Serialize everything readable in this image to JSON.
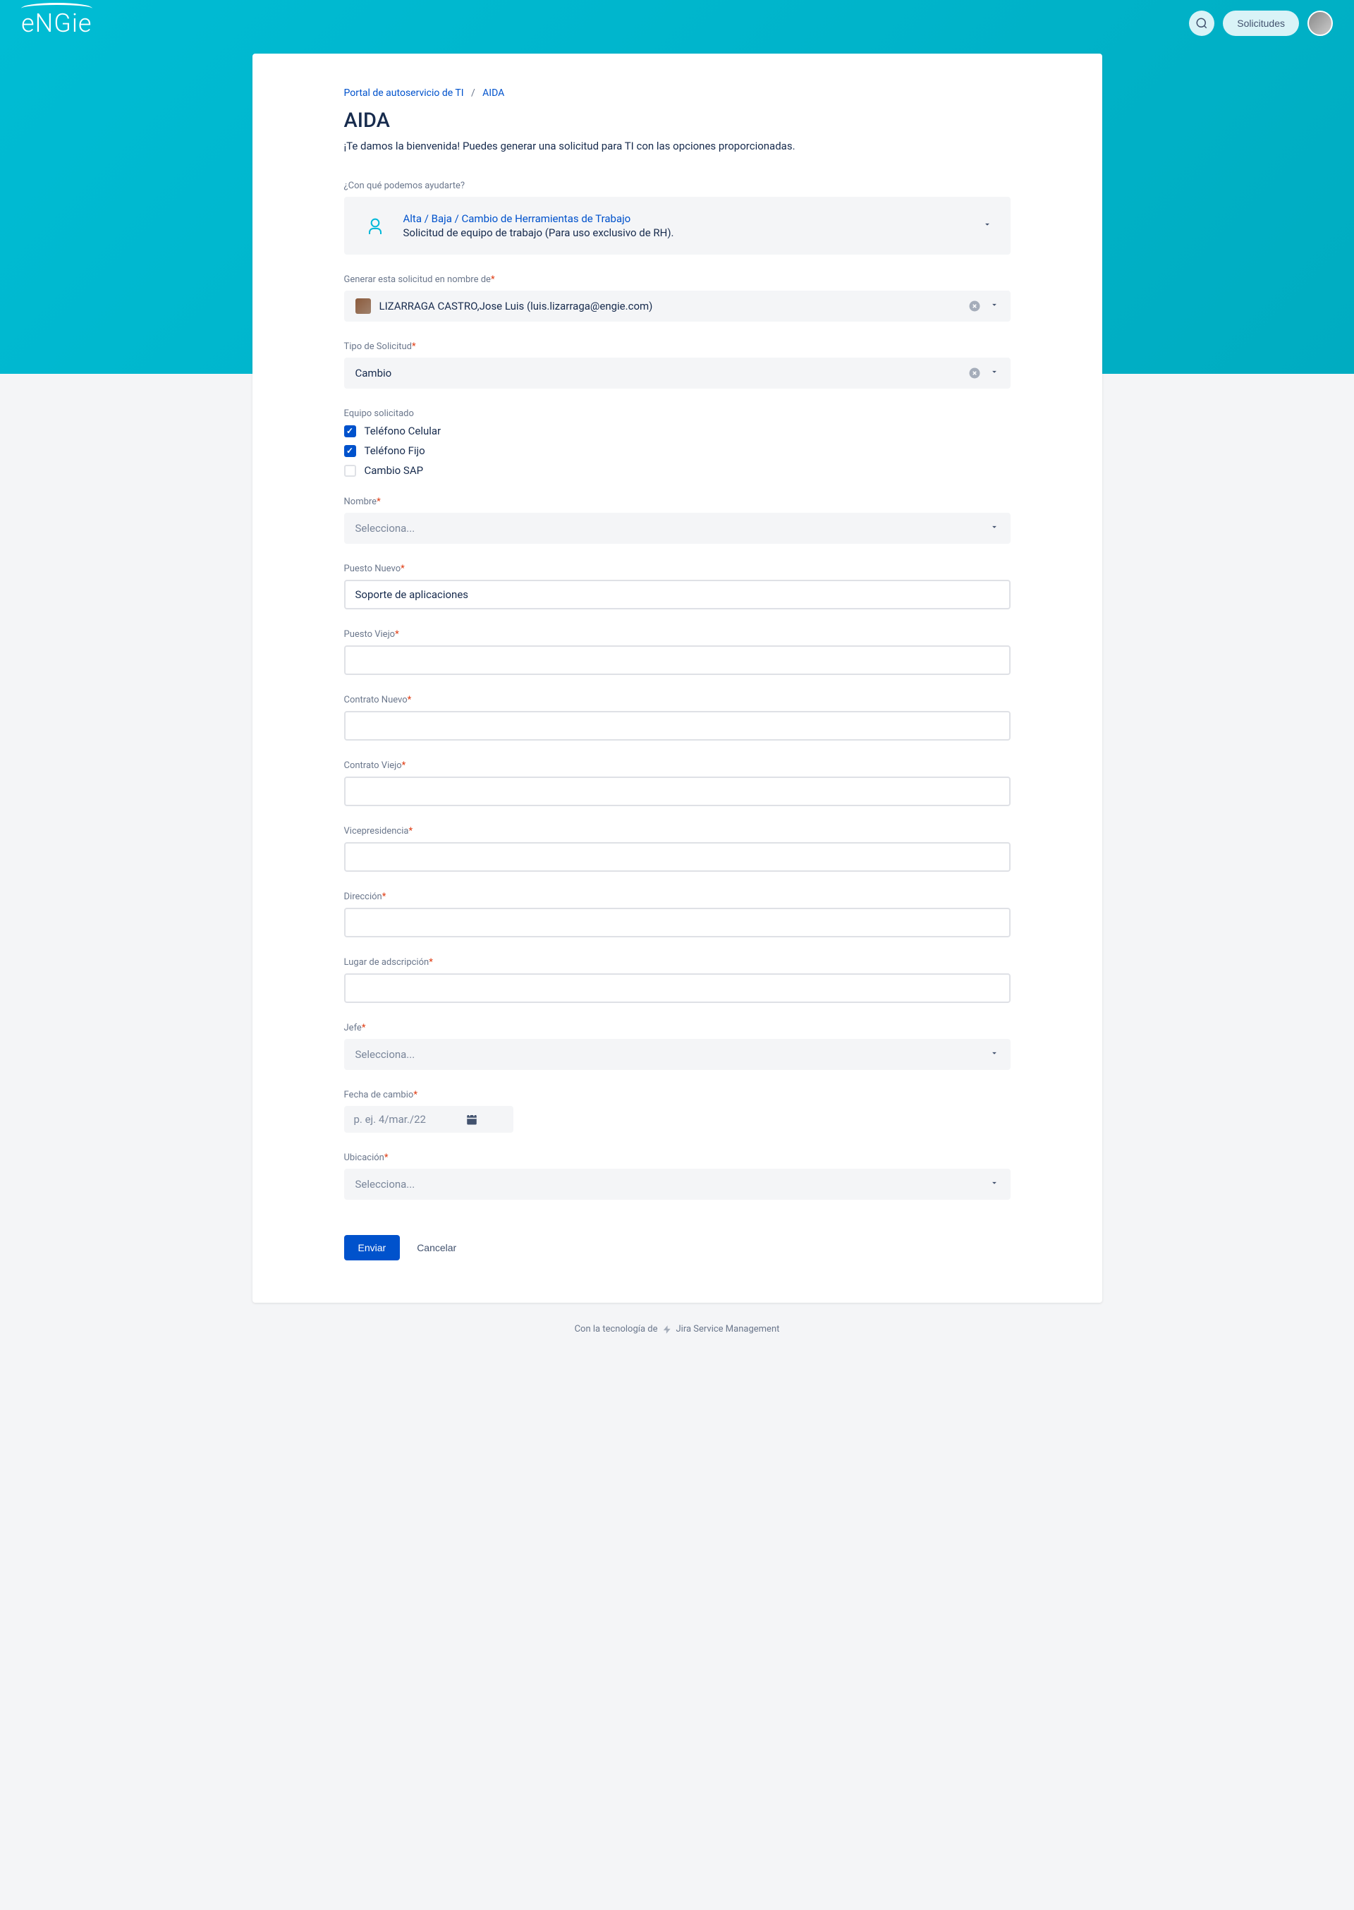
{
  "header": {
    "logo": "eNGie",
    "solicitudes": "Solicitudes"
  },
  "breadcrumb": {
    "portal": "Portal de autoservicio de TI",
    "separator": "/",
    "current": "AIDA"
  },
  "page": {
    "title": "AIDA",
    "subtitle": "¡Te damos la bienvenida! Puedes generar una solicitud para TI con las opciones proporcionadas."
  },
  "help": {
    "label": "¿Con qué podemos ayudarte?",
    "type_title": "Alta / Baja / Cambio de Herramientas de Trabajo",
    "type_desc": "Solicitud de equipo de trabajo (Para uso exclusivo de RH)."
  },
  "fields": {
    "on_behalf_label": "Generar esta solicitud en nombre de",
    "on_behalf_value": "LIZARRAGA CASTRO,Jose Luis (luis.lizarraga@engie.com)",
    "tipo_label": "Tipo de Solicitud",
    "tipo_value": "Cambio",
    "equipo_label": "Equipo solicitado",
    "equipo_options": {
      "celular": "Teléfono Celular",
      "fijo": "Teléfono Fijo",
      "sap": "Cambio SAP"
    },
    "nombre_label": "Nombre",
    "nombre_placeholder": "Selecciona...",
    "puesto_nuevo_label": "Puesto Nuevo",
    "puesto_nuevo_value": "Soporte de aplicaciones",
    "puesto_viejo_label": "Puesto Viejo",
    "contrato_nuevo_label": "Contrato Nuevo",
    "contrato_viejo_label": "Contrato Viejo",
    "vicepresidencia_label": "Vicepresidencia",
    "direccion_label": "Dirección",
    "lugar_label": "Lugar de adscripción",
    "jefe_label": "Jefe",
    "jefe_placeholder": "Selecciona...",
    "fecha_label": "Fecha de cambio",
    "fecha_placeholder": "p. ej. 4/mar./22",
    "ubicacion_label": "Ubicación",
    "ubicacion_placeholder": "Selecciona..."
  },
  "actions": {
    "submit": "Enviar",
    "cancel": "Cancelar"
  },
  "footer": {
    "powered_by": "Con la tecnología de",
    "product": "Jira Service Management"
  }
}
